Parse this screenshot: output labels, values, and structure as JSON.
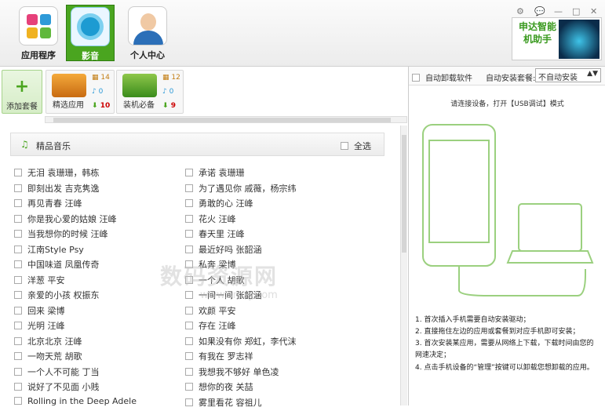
{
  "nav": {
    "apps": "应用程序",
    "media": "影音",
    "personal": "个人中心"
  },
  "window_controls": {
    "settings": "⚙",
    "feedback": "💬",
    "minimize": "—",
    "maximize": "□",
    "close": "✕"
  },
  "logo": {
    "text": "申达智能机助手"
  },
  "packages": {
    "add": "添加套餐",
    "items": [
      {
        "label": "精选应用",
        "grid": "14",
        "music": "0",
        "down": "10"
      },
      {
        "label": "装机必备",
        "grid": "12",
        "music": "0",
        "down": "9"
      }
    ]
  },
  "section": {
    "title": "精品音乐",
    "select_all": "全选"
  },
  "songs_left": [
    "无泪 袁珊珊，韩栋",
    "即刻出发 吉克隽逸",
    "再见青春 汪峰",
    "你是我心爱的姑娘 汪峰",
    "当我想你的时候 汪峰",
    "江南Style Psy",
    "中国味道 凤凰传奇",
    "洋葱 平安",
    "亲爱的小孩 权振东",
    "回来 梁博",
    "光明 汪峰",
    "北京北京 汪峰",
    "一吻天荒 胡歌",
    "一个人不可能 丁当",
    "说好了不见面 小贱",
    "Rolling in the Deep Adele"
  ],
  "songs_right": [
    "承诺 袁珊珊",
    "为了遇见你 戚薇，杨宗纬",
    "勇敢的心 汪峰",
    "花火 汪峰",
    "春天里 汪峰",
    "最近好吗 张韶涵",
    "私奔 梁博",
    "一个人 胡歌",
    "一间一间 张韶涵",
    "欢颜 平安",
    "存在 汪峰",
    "如果没有你 郑虹，李代沫",
    "有我在 罗志祥",
    "我想我不够好 单色凌",
    "想你的夜 关喆",
    "雾里看花 容祖儿"
  ],
  "watermark": {
    "main": "数码资源网",
    "sub": "www.smzy.com"
  },
  "right": {
    "auto_uninstall": "自动卸载软件",
    "auto_install_label": "自动安装套餐:",
    "auto_install_value": "不自动安装",
    "connect_prompt": "请连接设备，打开【USB调试】模式",
    "instructions": [
      {
        "num": "1.",
        "text": "首次插入手机需要自动安装驱动；"
      },
      {
        "num": "2.",
        "text": "直接拖住左边的应用或套餐到对应手机即可安装；"
      },
      {
        "num": "3.",
        "text": "首次安装某应用，需要从网络上下载，下载时间由您的网速决定；"
      },
      {
        "num": "4.",
        "text": "点击手机设备的“管理”按键可以卸载您想卸载的应用。"
      }
    ]
  }
}
